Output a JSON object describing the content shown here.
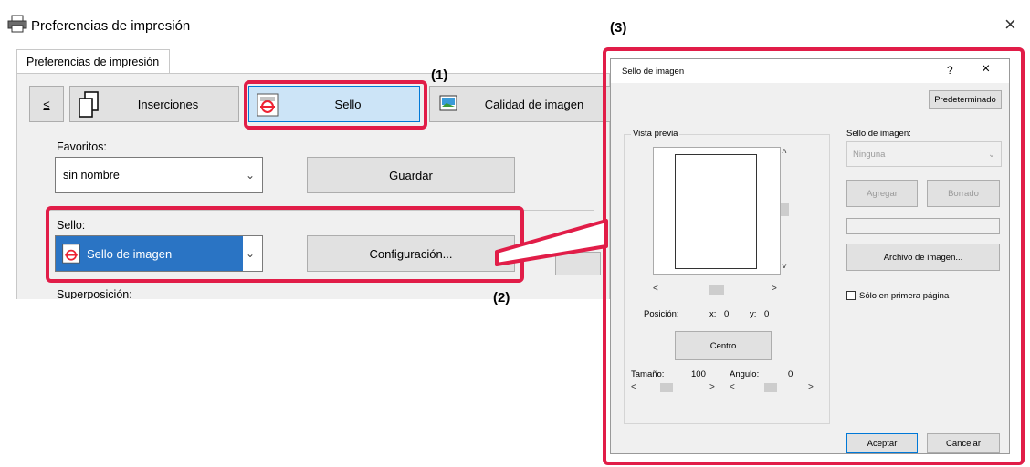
{
  "window": {
    "title": "Preferencias de impresión",
    "tab": "Preferencias de impresión",
    "close_glyph": "×"
  },
  "toolbar": {
    "prev": "≤",
    "inserciones": "Inserciones",
    "sello": "Sello",
    "calidad": "Calidad de imagen"
  },
  "favoritos": {
    "label": "Favoritos:",
    "value": "sin nombre",
    "save": "Guardar"
  },
  "sello": {
    "label": "Sello:",
    "value": "Sello de imagen",
    "config": "Configuración...",
    "superposicion": "Superposición:"
  },
  "annotations": {
    "n1": "(1)",
    "n2": "(2)",
    "n3": "(3)",
    "color": "#e11d48"
  },
  "dialog": {
    "title": "Sello de imagen",
    "help": "?",
    "close": "×",
    "default_button": "Predeterminado",
    "preview_label": "Vista previa",
    "stamp_label": "Sello de imagen:",
    "stamp_value": "Ninguna",
    "add": "Agregar",
    "delete": "Borrado",
    "image_file": "Archivo de imagen...",
    "first_page_only": "Sólo en primera página",
    "position_label": "Posición:",
    "x_label": "x:",
    "x_value": "0",
    "y_label": "y:",
    "y_value": "0",
    "center": "Centro",
    "size_label": "Tamaño:",
    "size_value": "100",
    "angle_label": "Angulo:",
    "angle_value": "0",
    "ok": "Aceptar",
    "cancel": "Cancelar"
  }
}
